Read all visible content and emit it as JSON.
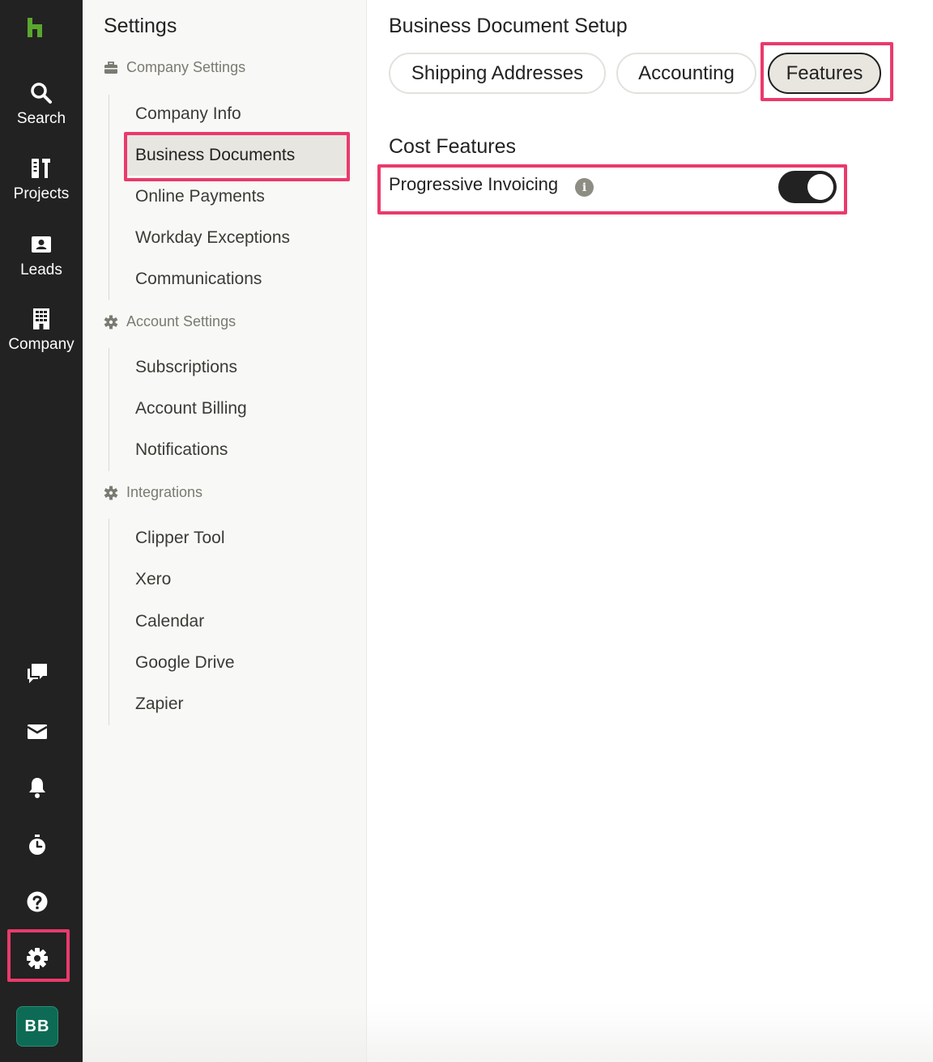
{
  "rail": {
    "items": [
      {
        "label": "Search",
        "icon": "search-icon"
      },
      {
        "label": "Projects",
        "icon": "projects-icon"
      },
      {
        "label": "Leads",
        "icon": "leads-icon"
      },
      {
        "label": "Company",
        "icon": "company-icon"
      }
    ],
    "bottom_icons": [
      "chat-icon",
      "mail-icon",
      "bell-icon",
      "timer-icon",
      "help-icon",
      "gear-icon"
    ],
    "avatar": "BB",
    "logo": "houzz-logo",
    "brand_color": "#5aa62e"
  },
  "settings": {
    "title": "Settings",
    "groups": [
      {
        "label": "Company Settings",
        "icon": "briefcase-icon",
        "items": [
          "Company Info",
          "Business Documents",
          "Online Payments",
          "Workday Exceptions",
          "Communications"
        ]
      },
      {
        "label": "Account Settings",
        "icon": "gear-icon",
        "items": [
          "Subscriptions",
          "Account Billing",
          "Notifications"
        ]
      },
      {
        "label": "Integrations",
        "icon": "gear-icon",
        "items": [
          "Clipper Tool",
          "Xero",
          "Calendar",
          "Google Drive",
          "Zapier"
        ]
      }
    ],
    "active_item": "Business Documents"
  },
  "main": {
    "title": "Business Document Setup",
    "tabs": [
      "Shipping Addresses",
      "Accounting",
      "Features"
    ],
    "active_tab": "Features",
    "section_title": "Cost Features",
    "feature": {
      "label": "Progressive Invoicing",
      "enabled": true
    }
  },
  "colors": {
    "highlight": "#ea3a6b",
    "avatar_bg": "#0d6b55",
    "rail_bg": "#222222"
  }
}
